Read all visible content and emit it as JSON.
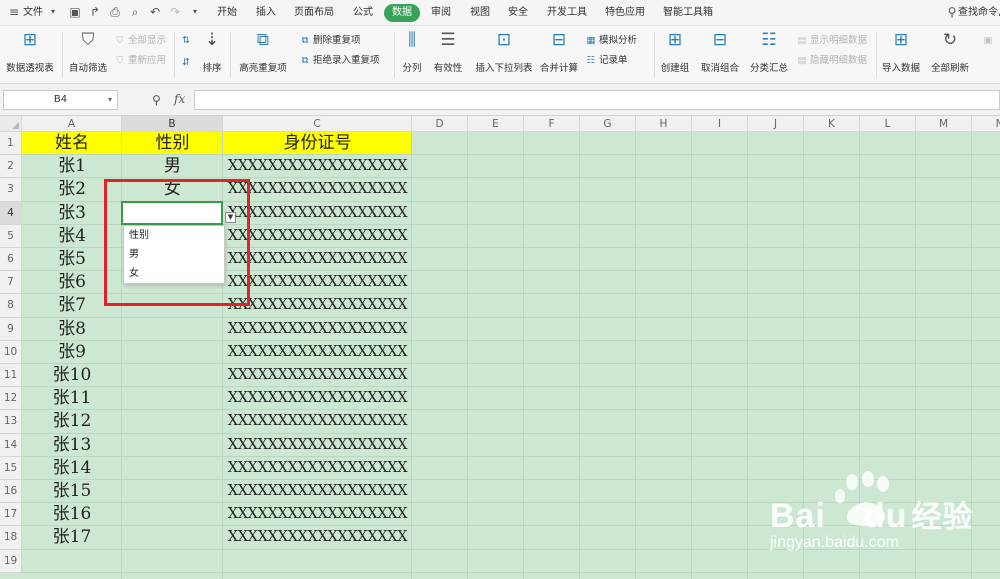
{
  "menubar": {
    "file_label": "文件",
    "menu_items": [
      "开始",
      "插入",
      "页面布局",
      "公式",
      "数据",
      "审阅",
      "视图",
      "安全",
      "开发工具",
      "特色应用",
      "智能工具箱"
    ],
    "active_menu": "数据",
    "search_label": "查找命令,"
  },
  "ribbon": {
    "pivot_table": "数据透视表",
    "auto_filter": "自动筛选",
    "show_all": "全部显示",
    "reapply": "重新应用",
    "sort": "排序",
    "highlight_duplicates": "高亮重复项",
    "remove_duplicates": "删除重复项",
    "reject_duplicates": "拒绝录入重复项",
    "split_column": "分列",
    "validity": "有效性",
    "insert_dropdown": "插入下拉列表",
    "consolidate": "合并计算",
    "what_if": "模拟分析",
    "record_form": "记录单",
    "create_group": "创建组",
    "ungroup": "取消组合",
    "subtotal": "分类汇总",
    "show_detail": "显示明细数据",
    "hide_detail": "隐藏明细数据",
    "import_data": "导入数据",
    "refresh_all": "全部刷新"
  },
  "formulabar": {
    "cell_ref": "B4",
    "fx_label": "fx",
    "formula_value": ""
  },
  "sheet": {
    "columns": [
      "A",
      "B",
      "C",
      "D",
      "E",
      "F",
      "G",
      "H",
      "I",
      "J",
      "K",
      "L",
      "M",
      "N"
    ],
    "rows": [
      "1",
      "2",
      "3",
      "4",
      "5",
      "6",
      "7",
      "8",
      "9",
      "10",
      "11",
      "12",
      "13",
      "14",
      "15",
      "16",
      "17",
      "18",
      "19"
    ],
    "active_column": "B",
    "active_row": "4",
    "header_fill": "#ffff00",
    "sheet_fill": "#cde8d2",
    "headers": [
      "姓名",
      "性别",
      "身份证号"
    ],
    "data": [
      {
        "name": "张1",
        "gender": "男",
        "id": "XXXXXXXXXXXXXXXXXX"
      },
      {
        "name": "张2",
        "gender": "女",
        "id": "XXXXXXXXXXXXXXXXXX"
      },
      {
        "name": "张3",
        "gender": "",
        "id": "XXXXXXXXXXXXXXXXXX"
      },
      {
        "name": "张4",
        "gender": "",
        "id": "XXXXXXXXXXXXXXXXXX"
      },
      {
        "name": "张5",
        "gender": "",
        "id": "XXXXXXXXXXXXXXXXXX"
      },
      {
        "name": "张6",
        "gender": "",
        "id": "XXXXXXXXXXXXXXXXXX"
      },
      {
        "name": "张7",
        "gender": "",
        "id": "XXXXXXXXXXXXXXXXXX"
      },
      {
        "name": "张8",
        "gender": "",
        "id": "XXXXXXXXXXXXXXXXXX"
      },
      {
        "name": "张9",
        "gender": "",
        "id": "XXXXXXXXXXXXXXXXXX"
      },
      {
        "name": "张10",
        "gender": "",
        "id": "XXXXXXXXXXXXXXXXXX"
      },
      {
        "name": "张11",
        "gender": "",
        "id": "XXXXXXXXXXXXXXXXXX"
      },
      {
        "name": "张12",
        "gender": "",
        "id": "XXXXXXXXXXXXXXXXXX"
      },
      {
        "name": "张13",
        "gender": "",
        "id": "XXXXXXXXXXXXXXXXXX"
      },
      {
        "name": "张14",
        "gender": "",
        "id": "XXXXXXXXXXXXXXXXXX"
      },
      {
        "name": "张15",
        "gender": "",
        "id": "XXXXXXXXXXXXXXXXXX"
      },
      {
        "name": "张16",
        "gender": "",
        "id": "XXXXXXXXXXXXXXXXXX"
      },
      {
        "name": "张17",
        "gender": "",
        "id": "XXXXXXXXXXXXXXXXXX"
      }
    ]
  },
  "dropdown": {
    "options": [
      "性别",
      "男",
      "女"
    ]
  },
  "annotation": {
    "color": "#e02424"
  },
  "watermark": {
    "brand": "Bai",
    "brand2": "du",
    "cn": "经验",
    "url": "jingyan.baidu.com"
  }
}
